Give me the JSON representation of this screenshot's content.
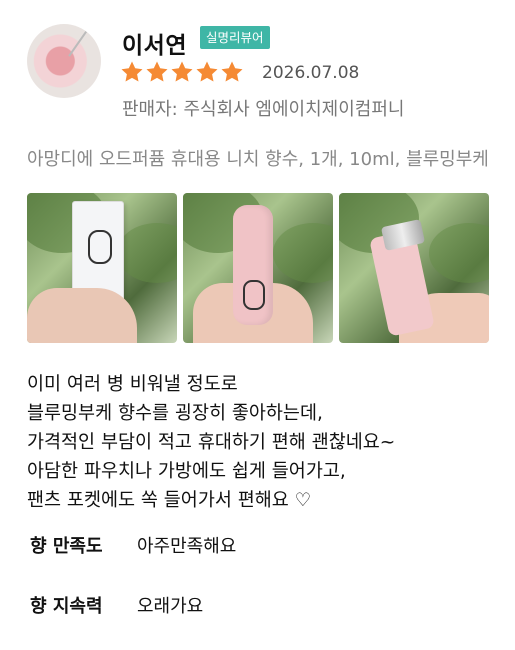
{
  "reviewer": {
    "name": "이서연",
    "badge": "실명리뷰어",
    "date": "2026.07.08",
    "seller": "판매자: 주식회사 엠에이치제이컴퍼니",
    "rating": 5,
    "star_color": "#f58a34",
    "badge_color": "#3fb6a6"
  },
  "product": {
    "title": "아망디에 오드퍼퓸 휴대용 니치 향수, 1개, 10ml, 블루밍부케"
  },
  "photos": [
    {
      "label": "product-box-photo"
    },
    {
      "label": "pink-tube-photo"
    },
    {
      "label": "pink-tube-cap-photo"
    }
  ],
  "review": {
    "lines": [
      "이미 여러 병 비워낼 정도로",
      "블루밍부케 향수를 굉장히 좋아하는데,",
      "가격적인 부담이 적고 휴대하기 편해 괜찮네요~",
      "아담한 파우치나 가방에도 쉽게 들어가고,",
      "팬츠 포켓에도 쏙 들어가서 편해요 ♡"
    ]
  },
  "attributes": [
    {
      "label": "향 만족도",
      "value": "아주만족해요"
    },
    {
      "label": "향 지속력",
      "value": "오래가요"
    }
  ]
}
